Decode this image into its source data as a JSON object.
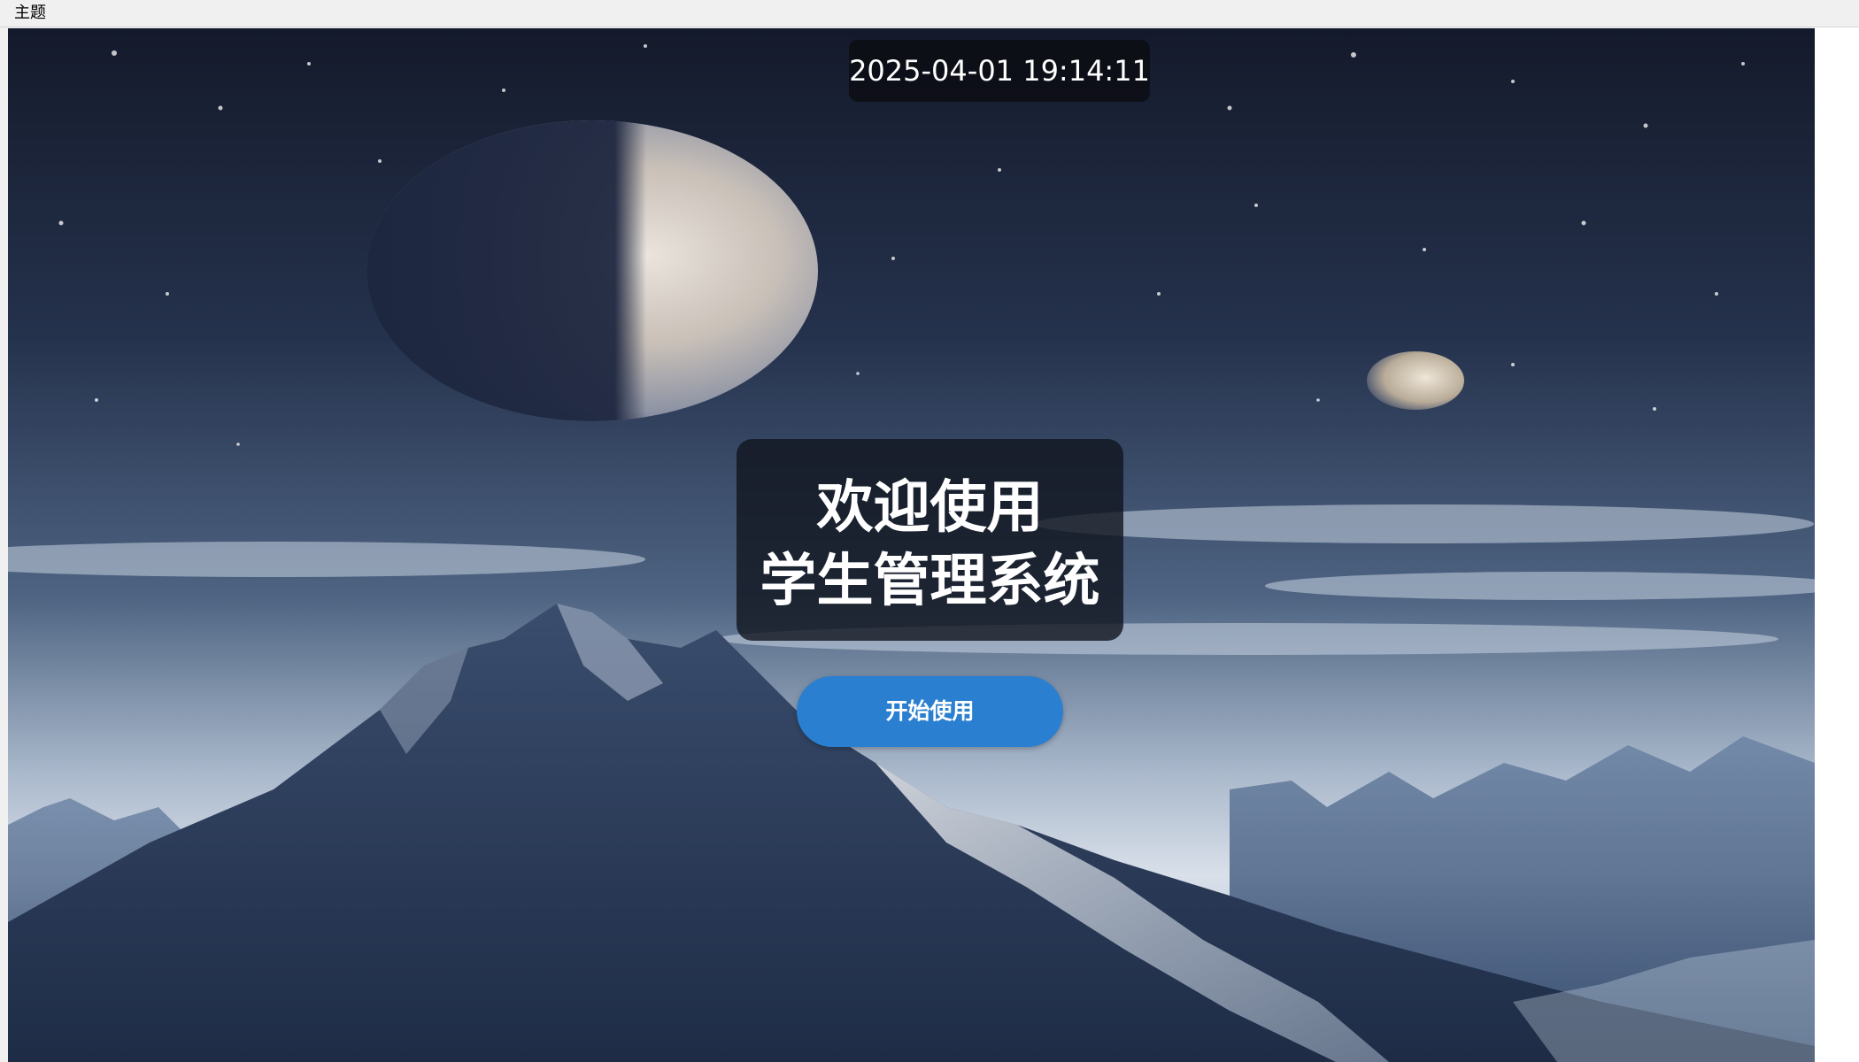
{
  "menubar": {
    "items": [
      {
        "label": "主题"
      }
    ]
  },
  "clock": {
    "datetime": "2025-04-01 19:14:11"
  },
  "welcome": {
    "line1": "欢迎使用",
    "line2": "学生管理系统"
  },
  "start_button": {
    "label": "开始使用"
  },
  "colors": {
    "accent_button": "#2a7fd0",
    "card_background": "#10141e",
    "sky_top": "#1b2436",
    "sky_horizon": "#b9c7d8"
  }
}
